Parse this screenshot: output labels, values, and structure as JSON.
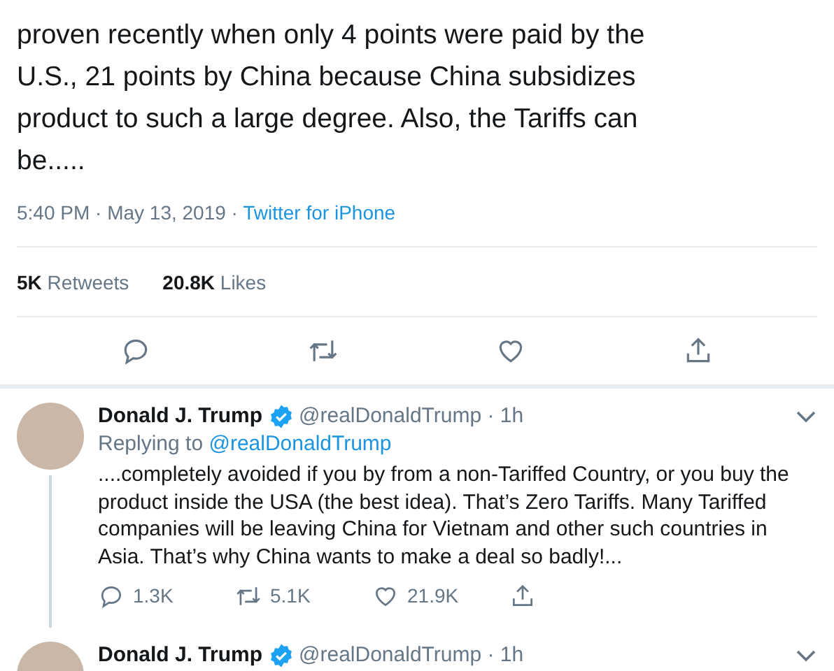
{
  "main_tweet": {
    "text": "proven recently when only 4 points were paid by the U.S., 21 points by China because China subsidizes product to such a large degree. Also, the Tariffs can be.....",
    "timestamp": "5:40 PM · May 13, 2019 · ",
    "source": "Twitter for iPhone",
    "stats": [
      {
        "count": "5K",
        "label": "Retweets"
      },
      {
        "count": "20.8K",
        "label": "Likes"
      }
    ],
    "actions": [
      {
        "kind": "reply"
      },
      {
        "kind": "retweet"
      },
      {
        "kind": "like"
      },
      {
        "kind": "share"
      }
    ]
  },
  "replies": [
    {
      "name": "Donald J. Trump",
      "verified": true,
      "handle": "@realDonaldTrump · 1h",
      "replying_label": "Replying to",
      "replying_to": "@realDonaldTrump",
      "thread_line": true,
      "text": "....completely avoided if you by from a non-Tariffed Country, or you buy the product inside the USA (the best idea). That’s Zero Tariffs. Many Tariffed companies will be leaving China for Vietnam and other such countries in Asia. That’s why China wants to make a deal so badly!...",
      "actions": [
        {
          "kind": "reply",
          "count": "1.3K"
        },
        {
          "kind": "retweet",
          "count": "5.1K"
        },
        {
          "kind": "like",
          "count": "21.9K"
        },
        {
          "kind": "share"
        }
      ]
    },
    {
      "name": "Donald J. Trump",
      "verified": true,
      "handle": "@realDonaldTrump · 1h"
    }
  ]
}
